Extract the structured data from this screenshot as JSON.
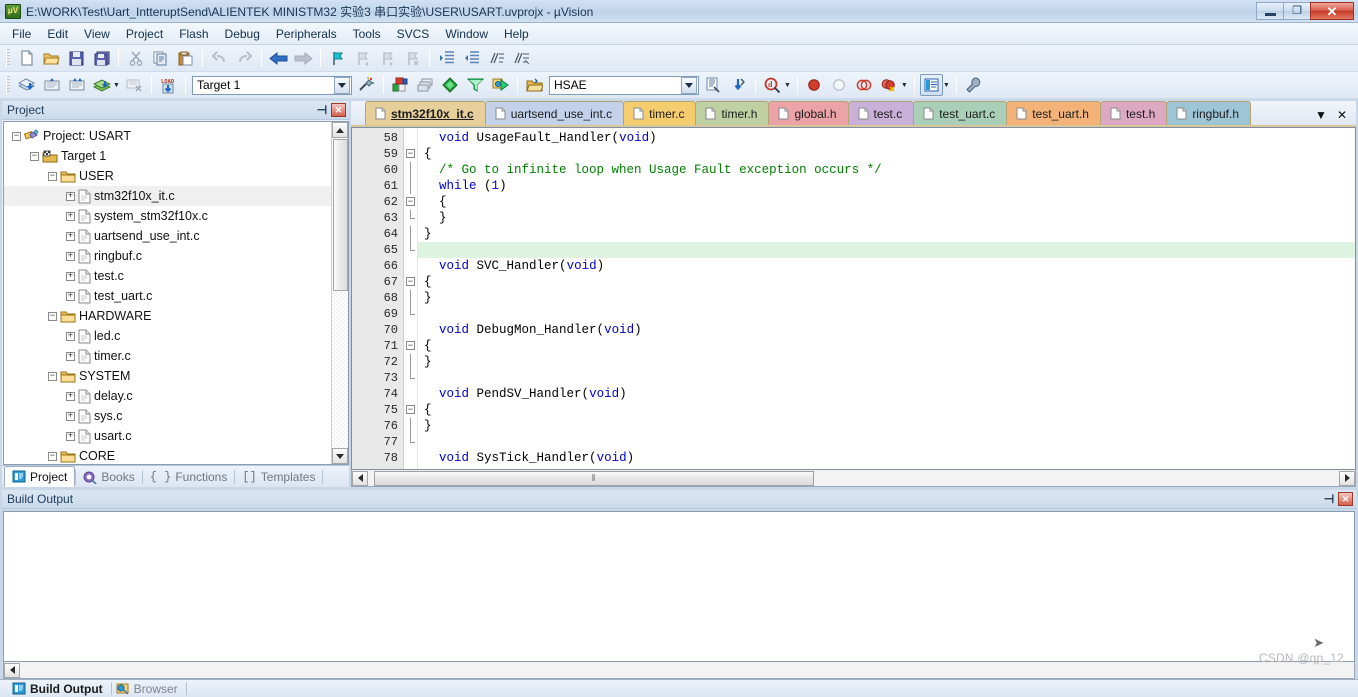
{
  "window": {
    "title": "E:\\WORK\\Test\\Uart_IntteruptSend\\ALIENTEK MINISTM32 实验3 串口实验\\USER\\USART.uvprojx - µVision",
    "app_icon": "uvision-logo-icon",
    "minimize_label": "",
    "restore_label": "❐",
    "close_label": "✕"
  },
  "menubar": {
    "items": [
      {
        "label": "File"
      },
      {
        "label": "Edit"
      },
      {
        "label": "View"
      },
      {
        "label": "Project"
      },
      {
        "label": "Flash"
      },
      {
        "label": "Debug"
      },
      {
        "label": "Peripherals"
      },
      {
        "label": "Tools"
      },
      {
        "label": "SVCS"
      },
      {
        "label": "Window"
      },
      {
        "label": "Help"
      }
    ]
  },
  "toolbar_row1": {
    "buttons": [
      {
        "name": "new-file-icon",
        "tip": "New"
      },
      {
        "name": "open-file-icon",
        "tip": "Open"
      },
      {
        "name": "save-icon",
        "tip": "Save"
      },
      {
        "name": "save-all-icon",
        "tip": "Save All"
      },
      {
        "name": "cut-icon",
        "tip": "Cut"
      },
      {
        "name": "copy-icon",
        "tip": "Copy"
      },
      {
        "name": "paste-icon",
        "tip": "Paste"
      },
      {
        "name": "undo-icon",
        "tip": "Undo"
      },
      {
        "name": "redo-icon",
        "tip": "Redo"
      },
      {
        "name": "navigate-back-icon",
        "tip": "Back"
      },
      {
        "name": "navigate-forward-icon",
        "tip": "Forward"
      },
      {
        "name": "bookmark-toggle-icon",
        "tip": "Insert/Remove Bookmark"
      },
      {
        "name": "bookmark-prev-icon",
        "tip": "Go to Previous Bookmark"
      },
      {
        "name": "bookmark-next-icon",
        "tip": "Go to Next Bookmark"
      },
      {
        "name": "bookmark-clear-icon",
        "tip": "Clear All Bookmarks"
      },
      {
        "name": "indent-icon",
        "tip": "Indent"
      },
      {
        "name": "outdent-icon",
        "tip": "Outdent"
      },
      {
        "name": "comment-icon",
        "tip": "Comment"
      },
      {
        "name": "uncomment-icon",
        "tip": "Uncomment"
      }
    ]
  },
  "toolbar_row2": {
    "buttons": [
      {
        "name": "translate-icon",
        "tip": "Translate"
      },
      {
        "name": "build-icon",
        "tip": "Build"
      },
      {
        "name": "rebuild-icon",
        "tip": "Rebuild"
      },
      {
        "name": "batch-build-icon",
        "tip": "Batch Build"
      },
      {
        "name": "stop-build-icon",
        "tip": "Stop Build"
      },
      {
        "name": "download-icon",
        "tip": "Download"
      }
    ],
    "target_select": {
      "value": "Target 1",
      "options": [
        "Target 1"
      ]
    },
    "after_target": [
      {
        "name": "target-options-icon",
        "tip": "Options for Target"
      },
      {
        "name": "manage-components-icon",
        "tip": "Manage Project Items"
      },
      {
        "name": "multi-project-icon",
        "tip": "Multi-Project"
      },
      {
        "name": "pack-installer-icon",
        "tip": "Pack Installer"
      },
      {
        "name": "manage-run-time-icon",
        "tip": "Manage Run-Time Environment"
      },
      {
        "name": "software-packs-icon",
        "tip": "Select Software Packs"
      }
    ],
    "browse_select": {
      "value": "HSAE",
      "options": [
        "HSAE"
      ]
    },
    "right_buttons": [
      {
        "name": "open-folder-icon",
        "tip": "Open Project Folder"
      },
      {
        "name": "source-browse-icon",
        "tip": "Browse"
      },
      {
        "name": "find-in-files-icon",
        "tip": "Find in Files"
      },
      {
        "name": "debug-session-icon",
        "tip": "Start/Stop Debug Session"
      },
      {
        "name": "insert-breakpoint-icon",
        "tip": "Insert/Remove Breakpoint"
      },
      {
        "name": "disable-breakpoint-icon",
        "tip": "Enable/Disable Breakpoint"
      },
      {
        "name": "disable-all-breakpoints-icon",
        "tip": "Disable All Breakpoints"
      },
      {
        "name": "kill-all-breakpoints-icon",
        "tip": "Kill All Breakpoints"
      },
      {
        "name": "window-layout-icon",
        "tip": "Window Layout"
      },
      {
        "name": "configuration-wizard-icon",
        "tip": "Configure"
      }
    ]
  },
  "project_pane": {
    "title": "Project",
    "pin_glyph": "⊣",
    "close_glyph": "✕",
    "tree": [
      {
        "depth": 0,
        "label": "Project: USART",
        "icon": "project-icon",
        "toggle": "minus",
        "selected": false
      },
      {
        "depth": 1,
        "label": "Target 1",
        "icon": "target-icon",
        "toggle": "minus",
        "selected": false
      },
      {
        "depth": 2,
        "label": "USER",
        "icon": "folder-icon",
        "toggle": "minus",
        "selected": false
      },
      {
        "depth": 3,
        "label": "stm32f10x_it.c",
        "icon": "c-file-icon",
        "toggle": "plus",
        "selected": true
      },
      {
        "depth": 3,
        "label": "system_stm32f10x.c",
        "icon": "c-file-icon",
        "toggle": "plus",
        "selected": false
      },
      {
        "depth": 3,
        "label": "uartsend_use_int.c",
        "icon": "c-file-icon",
        "toggle": "plus",
        "selected": false
      },
      {
        "depth": 3,
        "label": "ringbuf.c",
        "icon": "c-file-icon",
        "toggle": "plus",
        "selected": false
      },
      {
        "depth": 3,
        "label": "test.c",
        "icon": "c-file-icon",
        "toggle": "plus",
        "selected": false
      },
      {
        "depth": 3,
        "label": "test_uart.c",
        "icon": "c-file-icon",
        "toggle": "plus",
        "selected": false
      },
      {
        "depth": 2,
        "label": "HARDWARE",
        "icon": "folder-icon",
        "toggle": "minus",
        "selected": false
      },
      {
        "depth": 3,
        "label": "led.c",
        "icon": "c-file-icon",
        "toggle": "plus",
        "selected": false
      },
      {
        "depth": 3,
        "label": "timer.c",
        "icon": "c-file-icon",
        "toggle": "plus",
        "selected": false
      },
      {
        "depth": 2,
        "label": "SYSTEM",
        "icon": "folder-icon",
        "toggle": "minus",
        "selected": false
      },
      {
        "depth": 3,
        "label": "delay.c",
        "icon": "c-file-icon",
        "toggle": "plus",
        "selected": false
      },
      {
        "depth": 3,
        "label": "sys.c",
        "icon": "c-file-icon",
        "toggle": "plus",
        "selected": false
      },
      {
        "depth": 3,
        "label": "usart.c",
        "icon": "c-file-icon",
        "toggle": "plus",
        "selected": false
      },
      {
        "depth": 2,
        "label": "CORE",
        "icon": "folder-icon",
        "toggle": "minus",
        "selected": false
      }
    ],
    "tabs": [
      {
        "label": "Project",
        "icon": "project-tab-icon",
        "active": true
      },
      {
        "label": "Books",
        "icon": "books-icon",
        "active": false
      },
      {
        "label": "Functions",
        "icon": "functions-icon",
        "active": false
      },
      {
        "label": "Templates",
        "icon": "templates-icon",
        "active": false
      }
    ]
  },
  "editor": {
    "tabs": [
      {
        "label": "stm32f10x_it.c",
        "color": "#e6cf9a",
        "active": true
      },
      {
        "label": "uartsend_use_int.c",
        "color": "#c3d2ea",
        "active": false
      },
      {
        "label": "timer.c",
        "color": "#f5cd6e",
        "active": false
      },
      {
        "label": "timer.h",
        "color": "#bfd0a3",
        "active": false
      },
      {
        "label": "global.h",
        "color": "#eba3a8",
        "active": false
      },
      {
        "label": "test.c",
        "color": "#c9b0d8",
        "active": false
      },
      {
        "label": "test_uart.c",
        "color": "#a9cfb9",
        "active": false
      },
      {
        "label": "test_uart.h",
        "color": "#f3b277",
        "active": false
      },
      {
        "label": "test.h",
        "color": "#dda9c2",
        "active": false
      },
      {
        "label": "ringbuf.h",
        "color": "#9dc5d6",
        "active": false
      }
    ],
    "tab_overflow_glyph": "▼",
    "tab_close_glyph": "✕",
    "first_line_number": 58,
    "lines": [
      {
        "n": 58,
        "fold": "none",
        "hl": false,
        "tokens": [
          {
            "t": "  ",
            "c": ""
          },
          {
            "t": "void",
            "c": "kw"
          },
          {
            "t": " UsageFault_Handler(",
            "c": ""
          },
          {
            "t": "void",
            "c": "kw"
          },
          {
            "t": ")",
            "c": ""
          }
        ]
      },
      {
        "n": 59,
        "fold": "minus",
        "hl": false,
        "tokens": [
          {
            "t": "{",
            "c": ""
          }
        ]
      },
      {
        "n": 60,
        "fold": "bar",
        "hl": false,
        "tokens": [
          {
            "t": "  ",
            "c": ""
          },
          {
            "t": "/* Go to infinite loop when Usage Fault exception occurs */",
            "c": "cm"
          }
        ]
      },
      {
        "n": 61,
        "fold": "bar",
        "hl": false,
        "tokens": [
          {
            "t": "  ",
            "c": ""
          },
          {
            "t": "while",
            "c": "kw"
          },
          {
            "t": " (",
            "c": ""
          },
          {
            "t": "1",
            "c": "num"
          },
          {
            "t": ")",
            "c": ""
          }
        ]
      },
      {
        "n": 62,
        "fold": "minus",
        "hl": false,
        "tokens": [
          {
            "t": "  {",
            "c": ""
          }
        ]
      },
      {
        "n": 63,
        "fold": "endmark",
        "hl": false,
        "tokens": [
          {
            "t": "  }",
            "c": ""
          }
        ]
      },
      {
        "n": 64,
        "fold": "bar",
        "hl": false,
        "tokens": [
          {
            "t": "}",
            "c": ""
          }
        ]
      },
      {
        "n": 65,
        "fold": "end",
        "hl": true,
        "tokens": [
          {
            "t": "",
            "c": ""
          }
        ]
      },
      {
        "n": 66,
        "fold": "none",
        "hl": false,
        "tokens": [
          {
            "t": "  ",
            "c": ""
          },
          {
            "t": "void",
            "c": "kw"
          },
          {
            "t": " SVC_Handler(",
            "c": ""
          },
          {
            "t": "void",
            "c": "kw"
          },
          {
            "t": ")",
            "c": ""
          }
        ]
      },
      {
        "n": 67,
        "fold": "minus",
        "hl": false,
        "tokens": [
          {
            "t": "{",
            "c": ""
          }
        ]
      },
      {
        "n": 68,
        "fold": "bar",
        "hl": false,
        "tokens": [
          {
            "t": "}",
            "c": ""
          }
        ]
      },
      {
        "n": 69,
        "fold": "end",
        "hl": false,
        "tokens": [
          {
            "t": "",
            "c": ""
          }
        ]
      },
      {
        "n": 70,
        "fold": "none",
        "hl": false,
        "tokens": [
          {
            "t": "  ",
            "c": ""
          },
          {
            "t": "void",
            "c": "kw"
          },
          {
            "t": " DebugMon_Handler(",
            "c": ""
          },
          {
            "t": "void",
            "c": "kw"
          },
          {
            "t": ")",
            "c": ""
          }
        ]
      },
      {
        "n": 71,
        "fold": "minus",
        "hl": false,
        "tokens": [
          {
            "t": "{",
            "c": ""
          }
        ]
      },
      {
        "n": 72,
        "fold": "bar",
        "hl": false,
        "tokens": [
          {
            "t": "}",
            "c": ""
          }
        ]
      },
      {
        "n": 73,
        "fold": "end",
        "hl": false,
        "tokens": [
          {
            "t": "",
            "c": ""
          }
        ]
      },
      {
        "n": 74,
        "fold": "none",
        "hl": false,
        "tokens": [
          {
            "t": "  ",
            "c": ""
          },
          {
            "t": "void",
            "c": "kw"
          },
          {
            "t": " PendSV_Handler(",
            "c": ""
          },
          {
            "t": "void",
            "c": "kw"
          },
          {
            "t": ")",
            "c": ""
          }
        ]
      },
      {
        "n": 75,
        "fold": "minus",
        "hl": false,
        "tokens": [
          {
            "t": "{",
            "c": ""
          }
        ]
      },
      {
        "n": 76,
        "fold": "bar",
        "hl": false,
        "tokens": [
          {
            "t": "}",
            "c": ""
          }
        ]
      },
      {
        "n": 77,
        "fold": "end",
        "hl": false,
        "tokens": [
          {
            "t": "",
            "c": ""
          }
        ]
      },
      {
        "n": 78,
        "fold": "none",
        "hl": false,
        "tokens": [
          {
            "t": "  ",
            "c": ""
          },
          {
            "t": "void",
            "c": "kw"
          },
          {
            "t": " SysTick_Handler(",
            "c": ""
          },
          {
            "t": "void",
            "c": "kw"
          },
          {
            "t": ")",
            "c": ""
          }
        ]
      }
    ],
    "hscroll_grip": "⦀"
  },
  "build_output": {
    "title": "Build Output",
    "pin_glyph": "⊣",
    "close_glyph": "✕",
    "content": ""
  },
  "status_tabs": [
    {
      "label": "Build Output",
      "icon": "build-output-icon",
      "active": true
    },
    {
      "label": "Browser",
      "icon": "browser-icon",
      "active": false
    }
  ],
  "watermark": "CSDN @qp_12",
  "colors": {
    "keyword": "#0000d0",
    "comment": "#008000",
    "highlight_line": "#dff4e0",
    "active_tab": "#e6cf9a",
    "title_close": "#c33a26"
  }
}
